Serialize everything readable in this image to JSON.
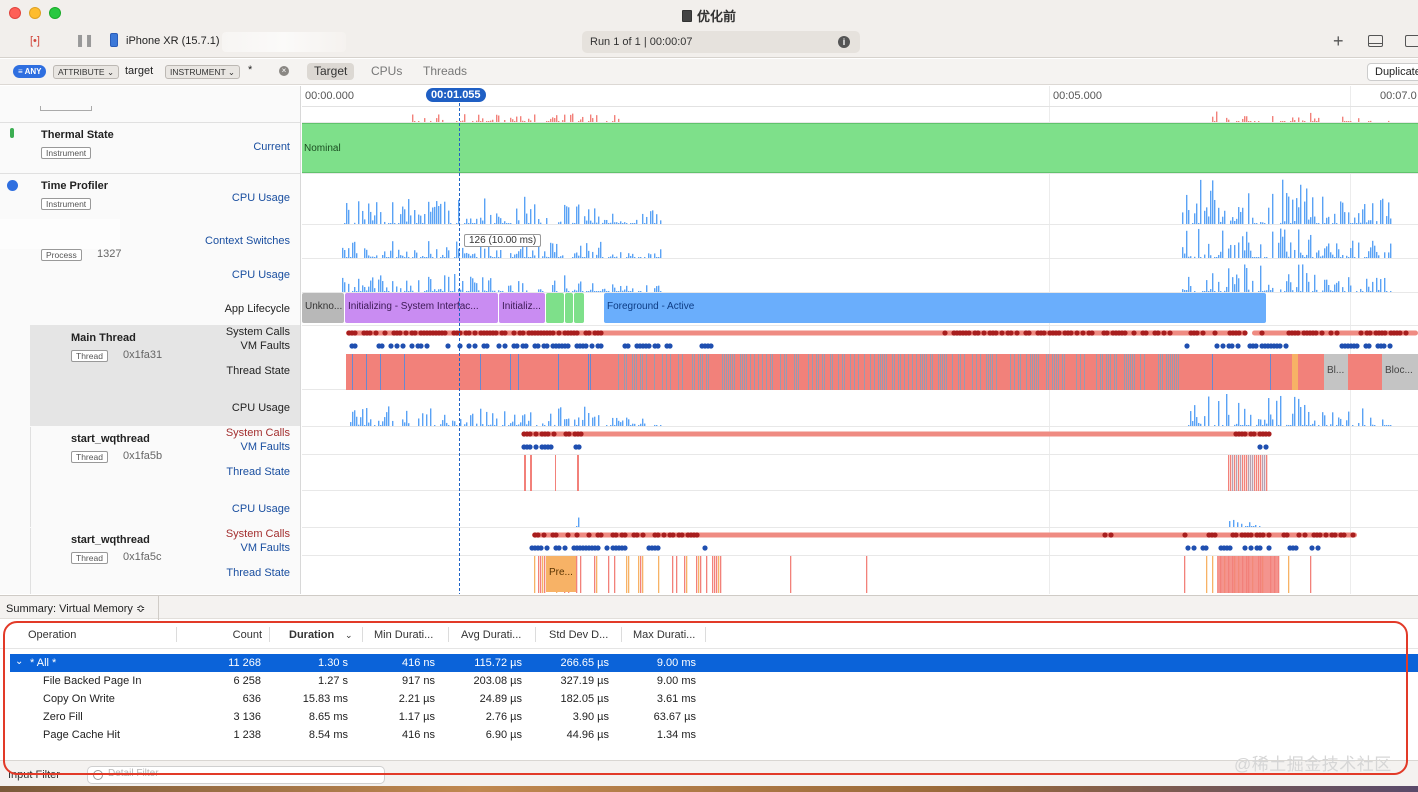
{
  "window": {
    "title": "优化前",
    "device": "iPhone XR (15.7.1)",
    "run_status": "Run 1 of 1  |  00:00:07"
  },
  "filter_bar": {
    "any_badge": "ANY",
    "attribute_pill": "ATTRIBUTE ⌄",
    "attribute_value": "target",
    "instrument_pill": "INSTRUMENT ⌄",
    "instrument_value": "*",
    "scopes": [
      "Target",
      "CPUs",
      "Threads"
    ],
    "selected_scope": "Target",
    "duplicate_button": "Duplicate"
  },
  "timeline": {
    "ruler_ticks": [
      "00:00.000",
      "00:05.000",
      "00:07.0"
    ],
    "cursor_time": "00:01.055",
    "context_callout": "126 (10.00 ms)",
    "tracks": {
      "thermal": {
        "title": "Thermal State",
        "tag": "Instrument",
        "lane": "Current",
        "state": "Nominal"
      },
      "time_profiler": {
        "title": "Time Profiler",
        "tag": "Instrument",
        "lane": "CPU Usage"
      },
      "process": {
        "tag": "Process",
        "pid": "1327",
        "lanes": [
          "Context Switches",
          "CPU Usage",
          "App Lifecycle"
        ]
      },
      "lifecycle_segments": [
        "Unkno...",
        "Initializing - System Interfac...",
        "Initializ...",
        "Foreground - Active"
      ],
      "main_thread": {
        "title": "Main Thread",
        "tag": "Thread",
        "tid": "0x1fa31",
        "lanes": [
          "System Calls",
          "VM Faults",
          "Thread State",
          "CPU Usage"
        ],
        "state_labels": [
          "Bl...",
          "Bloc..."
        ]
      },
      "wq1": {
        "title": "start_wqthread",
        "tag": "Thread",
        "tid": "0x1fa5b",
        "lanes": [
          "System Calls",
          "VM Faults",
          "Thread State",
          "CPU Usage"
        ]
      },
      "wq2": {
        "title": "start_wqthread",
        "tag": "Thread",
        "tid": "0x1fa5c",
        "lanes": [
          "System Calls",
          "VM Faults",
          "Thread State"
        ],
        "state_label": "Pre..."
      }
    }
  },
  "summary": {
    "title": "Summary: Virtual Memory ≎",
    "columns": [
      "Operation",
      "Count",
      "Duration",
      "Min Durati...",
      "Avg Durati...",
      "Std Dev D...",
      "Max Durati..."
    ],
    "rows": [
      {
        "operation": "* All *",
        "count": "11 268",
        "duration": "1.30 s",
        "min": "416 ns",
        "avg": "115.72 µs",
        "std": "266.65 µs",
        "max": "9.00 ms",
        "selected": true
      },
      {
        "operation": "File Backed Page In",
        "count": "6 258",
        "duration": "1.27 s",
        "min": "917 ns",
        "avg": "203.08 µs",
        "std": "327.19 µs",
        "max": "9.00 ms"
      },
      {
        "operation": "Copy On Write",
        "count": "636",
        "duration": "15.83 ms",
        "min": "2.21 µs",
        "avg": "24.89 µs",
        "std": "182.05 µs",
        "max": "3.61 ms"
      },
      {
        "operation": "Zero Fill",
        "count": "3 136",
        "duration": "8.65 ms",
        "min": "1.17 µs",
        "avg": "2.76 µs",
        "std": "3.90 µs",
        "max": "63.67 µs"
      },
      {
        "operation": "Page Cache Hit",
        "count": "1 238",
        "duration": "8.54 ms",
        "min": "416 ns",
        "avg": "6.90 µs",
        "std": "44.96 µs",
        "max": "1.34 ms"
      }
    ]
  },
  "footer": {
    "input_filter_label": "Input Filter",
    "detail_filter_placeholder": "Detail Filter",
    "watermark": "@稀土掘金技术社区"
  },
  "colors": {
    "accent": "#0b63d9",
    "nominal": "#7ee08a",
    "cpu_bars": "#5aa2f5",
    "thread_running": "#f2817a",
    "foreground_active": "#6aaefc",
    "initializing": "#c98cf2",
    "annotation": "#e23a28"
  }
}
